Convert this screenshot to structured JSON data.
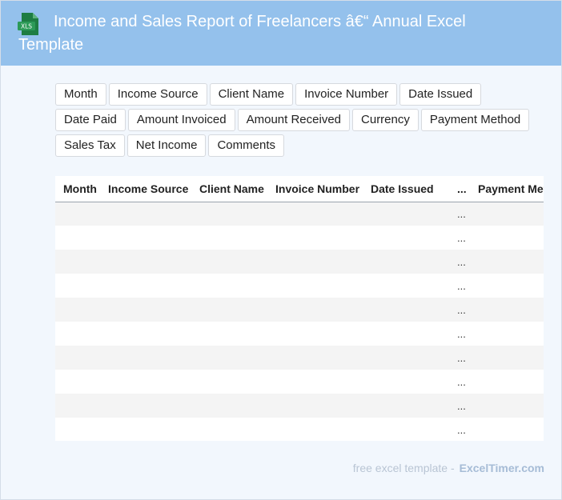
{
  "header": {
    "title": "Income and Sales Report of Freelancers â€“ Annual Excel Template",
    "icon_label": "XLS",
    "icon_color": "#1e7d43",
    "background": "#94c1ec"
  },
  "fields": [
    "Month",
    "Income Source",
    "Client Name",
    "Invoice Number",
    "Date Issued",
    "Date Paid",
    "Amount Invoiced",
    "Amount Received",
    "Currency",
    "Payment Method",
    "Sales Tax",
    "Net Income",
    "Comments"
  ],
  "table": {
    "columns": [
      "Month",
      "Income Source",
      "Client Name",
      "Invoice Number",
      "Date Issued",
      "...",
      "Payment Method"
    ],
    "rows": [
      [
        "",
        "",
        "",
        "",
        "",
        "...",
        ""
      ],
      [
        "",
        "",
        "",
        "",
        "",
        "...",
        ""
      ],
      [
        "",
        "",
        "",
        "",
        "",
        "...",
        ""
      ],
      [
        "",
        "",
        "",
        "",
        "",
        "...",
        ""
      ],
      [
        "",
        "",
        "",
        "",
        "",
        "...",
        ""
      ],
      [
        "",
        "",
        "",
        "",
        "",
        "...",
        ""
      ],
      [
        "",
        "",
        "",
        "",
        "",
        "...",
        ""
      ],
      [
        "",
        "",
        "",
        "",
        "",
        "...",
        ""
      ],
      [
        "",
        "",
        "",
        "",
        "",
        "...",
        ""
      ],
      [
        "",
        "",
        "",
        "",
        "",
        "...",
        ""
      ]
    ]
  },
  "footer": {
    "text": "free excel template -",
    "brand": "ExcelTimer.com"
  }
}
